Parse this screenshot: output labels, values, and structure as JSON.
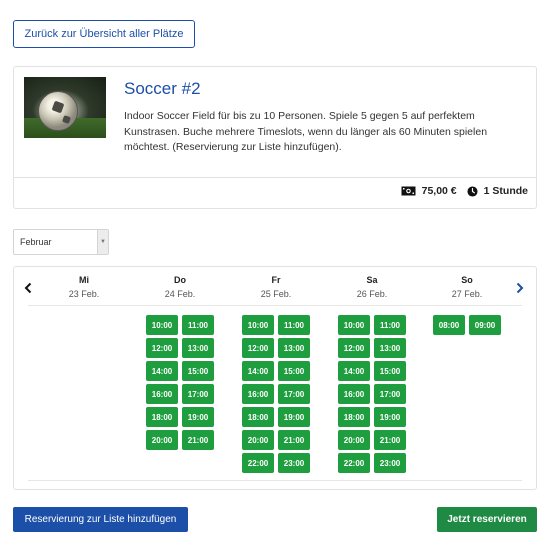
{
  "back_button": "Zurück zur Übersicht aller Plätze",
  "card": {
    "title": "Soccer #2",
    "description": "Indoor Soccer Field für bis zu 10 Personen. Spiele 5 gegen 5 auf perfektem Kunstrasen. Buche mehrere Timeslots, wenn du länger als 60 Minuten spielen möchtest. (Reservierung zur Liste hinzufügen).",
    "price": "75,00 €",
    "duration": "1 Stunde",
    "price_icon": "money-icon",
    "duration_icon": "clock-icon"
  },
  "month_select": {
    "value": "Februar"
  },
  "calendar": {
    "days": [
      {
        "name": "Mi",
        "date": "23 Feb.",
        "slots": []
      },
      {
        "name": "Do",
        "date": "24 Feb.",
        "slots": [
          "10:00",
          "11:00",
          "12:00",
          "13:00",
          "14:00",
          "15:00",
          "16:00",
          "17:00",
          "18:00",
          "19:00",
          "20:00",
          "21:00"
        ]
      },
      {
        "name": "Fr",
        "date": "25 Feb.",
        "slots": [
          "10:00",
          "11:00",
          "12:00",
          "13:00",
          "14:00",
          "15:00",
          "16:00",
          "17:00",
          "18:00",
          "19:00",
          "20:00",
          "21:00",
          "22:00",
          "23:00"
        ]
      },
      {
        "name": "Sa",
        "date": "26 Feb.",
        "slots": [
          "10:00",
          "11:00",
          "12:00",
          "13:00",
          "14:00",
          "15:00",
          "16:00",
          "17:00",
          "18:00",
          "19:00",
          "20:00",
          "21:00",
          "22:00",
          "23:00"
        ]
      },
      {
        "name": "So",
        "date": "27 Feb.",
        "slots": [
          "08:00",
          "09:00"
        ]
      }
    ],
    "prev_icon": "chevron-left-icon",
    "next_icon": "chevron-right-icon"
  },
  "colors": {
    "primary_blue": "#1c4fa8",
    "slot_green": "#1e9e3e",
    "reserve_green": "#1e8a43"
  },
  "actions": {
    "add_to_list": "Reservierung zur Liste hinzufügen",
    "reserve_now": "Jetzt reservieren"
  }
}
